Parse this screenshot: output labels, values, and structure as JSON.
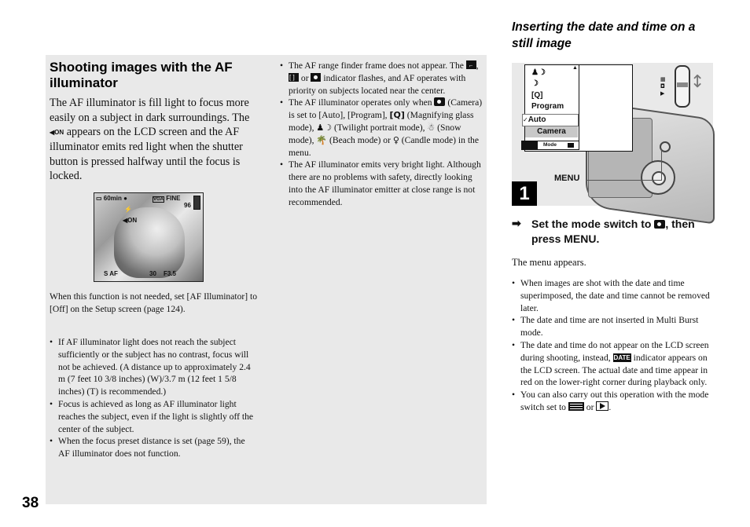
{
  "page": {
    "number": "38"
  },
  "left": {
    "heading": "Shooting images with the AF illuminator",
    "intro_before_icon": "The AF illuminator is fill light to focus more easily on a subject in dark surroundings. The ",
    "intro_icon": "AF-illuminator-on-icon",
    "intro_icon_text": "◀ON",
    "intro_after_icon": " appears on the LCD screen and the AF illuminator emits red light when the shutter button is pressed halfway until the focus is locked.",
    "lcd": {
      "battery_time": "60min",
      "image_size": "VGA",
      "quality": "FINE",
      "remaining": "96",
      "af_on": "◀ON",
      "flash": "⚡",
      "focus_mode": "S AF",
      "shutter": "30",
      "aperture": "F3.5"
    },
    "note": "When this function is not needed, set [AF Illuminator] to [Off] on the Setup screen (page 124).",
    "bullets": [
      "If AF illuminator light does not reach the subject sufficiently or the subject has no contrast, focus will not be achieved. (A distance up to approximately 2.4 m (7 feet 10 3/8 inches) (W)/3.7 m (12 feet 1 5/8 inches) (T) is recommended.)",
      "Focus is achieved as long as AF illuminator light reaches the subject, even if the light is slightly off the center of the subject.",
      "When the focus preset distance is set (page 59), the AF illuminator does not function."
    ]
  },
  "middle": {
    "bullet1": {
      "part1": "The AF range finder frame does not appear. The ",
      "sep1": ", ",
      "sep2": " or ",
      "part2": " indicator flashes, and AF operates with priority on subjects located near the center."
    },
    "bullet2": {
      "part1": "The AF illuminator operates only when ",
      "part2": " (Camera) is set to [Auto], [Program], ",
      "magnify_icon": "[Q]",
      "part3": " (Magnifying glass mode), ",
      "twilight_icon": "♟☽",
      "part4": " (Twilight portrait mode), ",
      "snow_icon": "☃",
      "part5": " (Snow mode), ",
      "beach_icon": "🌴",
      "part6": " (Beach mode) or ",
      "candle_icon": "♀",
      "part7": " (Candle mode) in the menu."
    },
    "bullet3": "The AF illuminator emits very bright light. Although there are no problems with safety, directly looking into the AF illuminator emitter at close range is not recommended."
  },
  "right": {
    "title": "Inserting the date and time on a still image",
    "menu": {
      "items": [
        "♟☽",
        "☽",
        "[Q]",
        "Program"
      ],
      "selected": "Auto",
      "check": "✓",
      "category": "Camera",
      "bar_label": "Mode",
      "scroll_up": "▲"
    },
    "switch_labels": [
      "▦",
      "◘",
      "▶"
    ],
    "updown_arrow": "↕",
    "menu_button_label": "MENU",
    "step_number": "1",
    "step_arrow": "➡",
    "step_text_1": "Set the mode switch to ",
    "step_text_2": ", then press MENU.",
    "menu_appears": "The menu appears.",
    "bullets": {
      "b1": "When images are shot with the date and time superimposed, the date and time cannot be removed later.",
      "b2": "The date and time are not inserted in Multi Burst mode.",
      "b3_part1": "The date and time do not appear on the LCD screen during shooting, instead, ",
      "b3_icon": "DATE",
      "b3_part2": " indicator appears on the LCD screen. The actual date and time appear in red on the lower-right corner during playback only.",
      "b4_part1": "You can also carry out this operation with the mode switch set to ",
      "b4_sep": " or ",
      "b4_end": "."
    }
  }
}
